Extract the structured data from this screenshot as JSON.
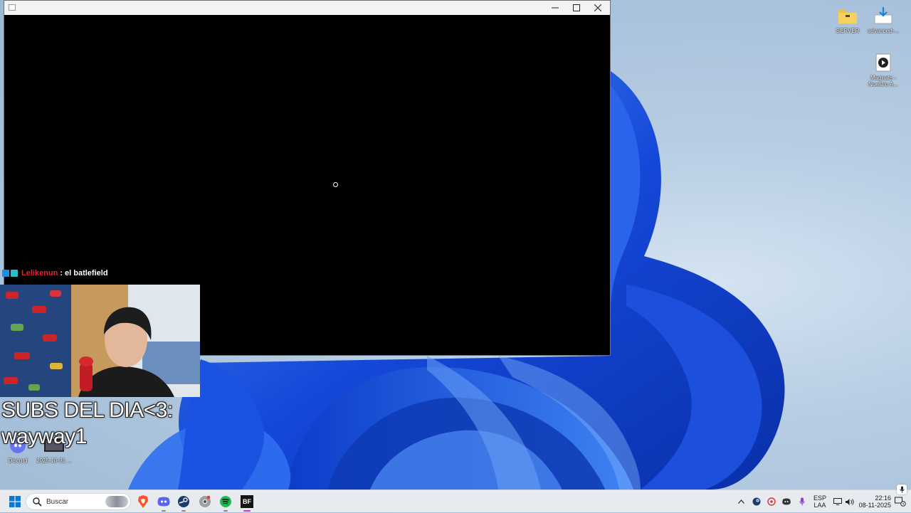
{
  "desktop": {
    "icons": [
      {
        "label": "SERVER",
        "icon": "folder-icon"
      },
      {
        "label": "advanced-...",
        "icon": "download-icon"
      },
      {
        "label": "Magnate - Nuestro A...",
        "icon": "media-play-icon"
      },
      {
        "label": "Discord",
        "icon": "discord-icon"
      },
      {
        "label": "2025-10-31 ...",
        "icon": "video-file-icon"
      }
    ]
  },
  "app_window": {
    "title": "",
    "controls": {
      "minimize": "—",
      "maximize": "☐",
      "close": "✕"
    },
    "content": "loading"
  },
  "stream_overlay": {
    "chat": {
      "username": "Lelikenun",
      "separator": ":",
      "message": "el batlefield",
      "user_color": "#e8232d"
    },
    "subs_title": "SUBS DEL DIA<3:",
    "subs_name": "wayway1"
  },
  "taskbar": {
    "search_placeholder": "Buscar",
    "pinned_apps": [
      "start-icon",
      "brave-browser-icon",
      "discord-icon",
      "steam-icon",
      "chrome-icon",
      "spotify-icon",
      "bf-app-icon"
    ],
    "active_app": "BF",
    "tray": {
      "language": "ESP",
      "layout": "LAA",
      "time": "22:16",
      "date": "08-11-2025"
    }
  },
  "colors": {
    "wallpaper_blue": "#1f55e0",
    "taskbar": "#e7ebf0",
    "spotify": "#1db954",
    "brave": "#fb542b",
    "discord": "#5865f2"
  }
}
